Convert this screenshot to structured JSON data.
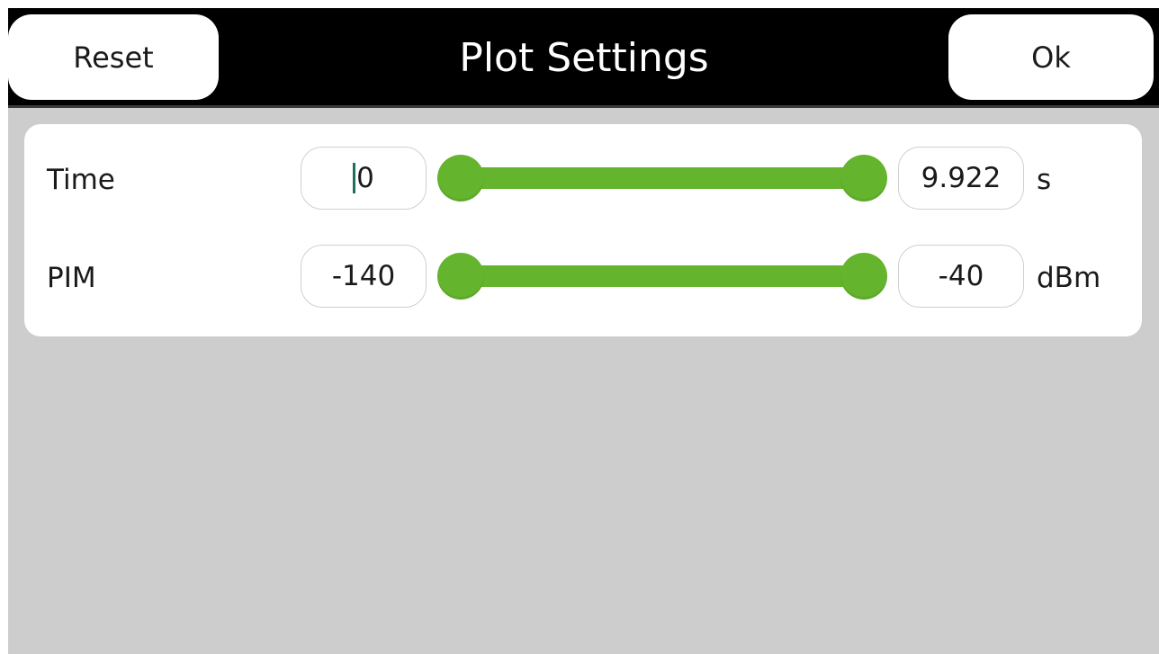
{
  "header": {
    "title": "Plot Settings",
    "reset_label": "Reset",
    "ok_label": "Ok"
  },
  "rows": [
    {
      "label": "Time",
      "min_value": "0",
      "max_value": "9.922",
      "unit": "s",
      "slider_low_fraction": 0.0,
      "slider_high_fraction": 1.0
    },
    {
      "label": "PIM",
      "min_value": "-140",
      "max_value": "-40",
      "unit": "dBm",
      "slider_low_fraction": 0.0,
      "slider_high_fraction": 1.0
    }
  ],
  "colors": {
    "accent_green": "#64b42d",
    "titlebar": "#000000",
    "background": "#cdcdcd",
    "cursor": "#1f6f5f"
  },
  "icons": {
    "slider_thumb": "circle-thumb"
  }
}
